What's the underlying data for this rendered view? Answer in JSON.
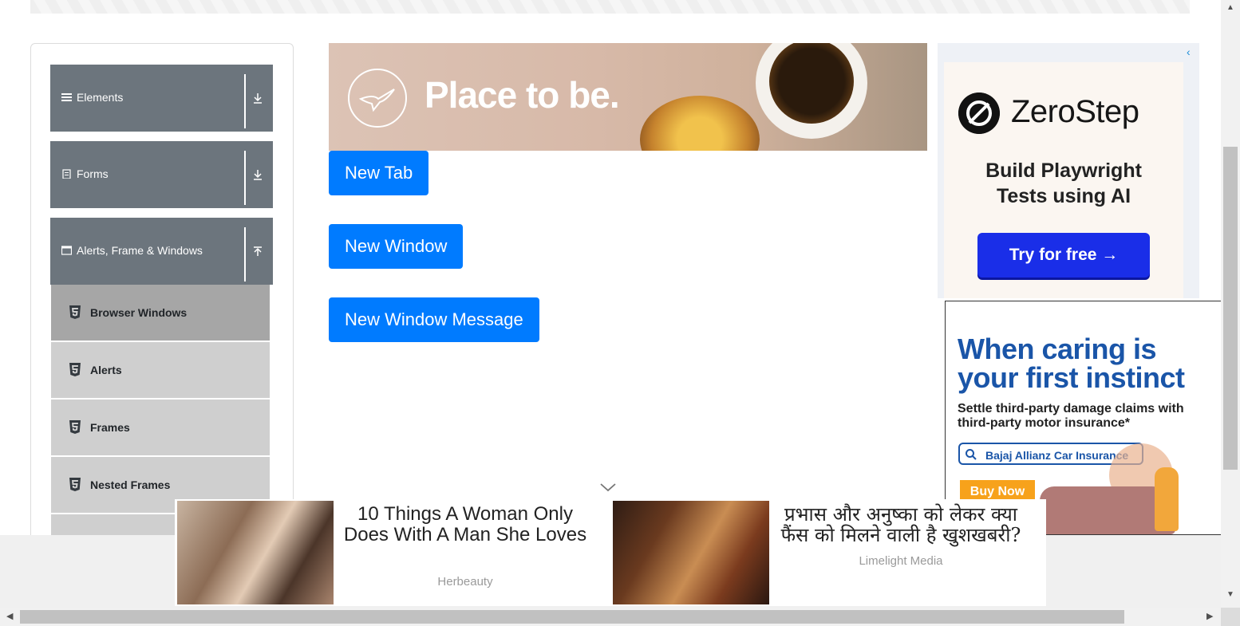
{
  "sidebar": {
    "groups": [
      {
        "label": "Elements",
        "icon": "hamburger-icon",
        "arrow": "download-icon"
      },
      {
        "label": "Forms",
        "icon": "form-icon",
        "arrow": "download-icon"
      },
      {
        "label": "Alerts, Frame & Windows",
        "icon": "window-icon",
        "arrow": "upload-icon"
      }
    ],
    "items": [
      {
        "label": "Browser Windows",
        "active": true
      },
      {
        "label": "Alerts",
        "active": false
      },
      {
        "label": "Frames",
        "active": false
      },
      {
        "label": "Nested Frames",
        "active": false
      }
    ]
  },
  "main": {
    "buttons": {
      "new_tab": "New Tab",
      "new_window": "New Window",
      "new_window_message": "New Window Message"
    }
  },
  "ads": {
    "top_banner": {
      "slogan": "Place to be."
    },
    "zerostep": {
      "brand": "ZeroStep",
      "tagline_1": "Build Playwright",
      "tagline_2": "Tests using AI",
      "cta": "Try for free →"
    },
    "bajaj": {
      "headline_1": "When caring is",
      "headline_2": "your first instinct",
      "sub_1": "Settle third-party damage claims with",
      "sub_2": "third-party motor insurance*",
      "search": "Bajaj Allianz Car Insurance",
      "cta": "Buy Now"
    },
    "bottom": [
      {
        "title": "10 Things A Woman Only Does With A Man She Loves",
        "source": "Herbeauty"
      },
      {
        "title": "प्रभास और अनुष्का को लेकर क्या फैंस को मिलने वाली है खुशखबरी?",
        "source": "Limelight Media"
      }
    ]
  },
  "colors": {
    "primary_button": "#007bff",
    "sidebar_group": "#6c757d",
    "sidebar_item": "#cfcfcf",
    "sidebar_item_active": "#a6a6a6"
  }
}
